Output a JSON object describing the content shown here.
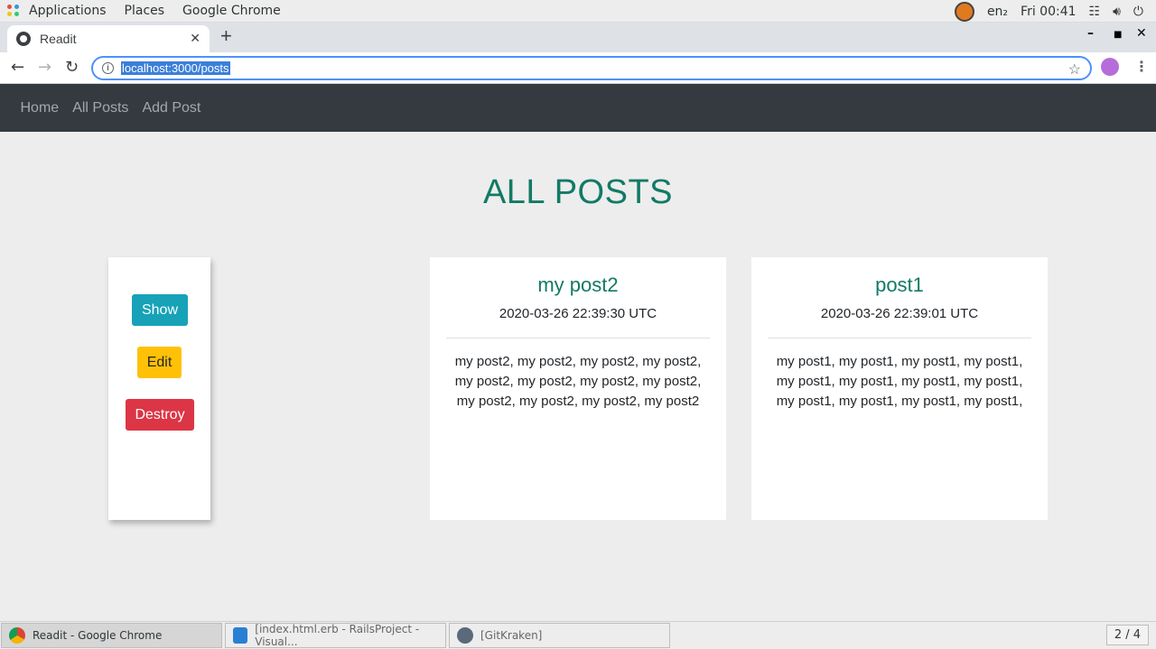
{
  "topbar": {
    "menus": [
      "Applications",
      "Places",
      "Google Chrome"
    ],
    "language": "en₂",
    "clock": "Fri 00:41"
  },
  "browser": {
    "tab_title": "Readit",
    "url": "localhost:3000/posts"
  },
  "site_nav": [
    "Home",
    "All Posts",
    "Add Post"
  ],
  "page": {
    "title": "ALL POSTS",
    "actions": {
      "show": "Show",
      "edit": "Edit",
      "destroy": "Destroy"
    },
    "posts": [
      {
        "title": "my post2",
        "date": "2020-03-26 22:39:30 UTC",
        "body": "my post2, my post2, my post2, my post2, my post2, my post2, my post2, my post2, my post2, my post2, my post2, my post2"
      },
      {
        "title": "post1",
        "date": "2020-03-26 22:39:01 UTC",
        "body": "my post1, my post1, my post1, my post1, my post1, my post1, my post1, my post1, my post1, my post1, my post1, my post1,"
      }
    ]
  },
  "taskbar": {
    "tasks": [
      "Readit - Google Chrome",
      "[index.html.erb - RailsProject - Visual...",
      "[GitKraken]"
    ],
    "workspace": "2 / 4"
  },
  "colors": {
    "accent": "#117a65",
    "navbar": "#343a40",
    "show": "#17a2b8",
    "edit": "#ffc107",
    "destroy": "#dc3545"
  }
}
